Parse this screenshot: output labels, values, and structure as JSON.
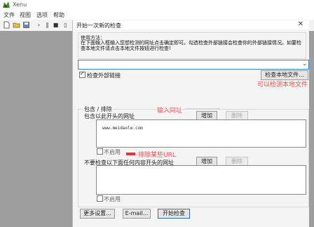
{
  "app": {
    "title": "Xenu"
  },
  "menu": [
    "文件",
    "视图",
    "选项",
    "帮助"
  ],
  "dialog": {
    "title": "开始一次新的检查",
    "usage_title": "使用方法：",
    "usage_text": "在下面输入框输入您想检测的网址点击确定即可。勾选检查外部链接会检查你的外部链接情况。如要检查本地文件请点击本地文件按钮进行检查!",
    "url_value": "",
    "check_external_label": "检查外部链接",
    "check_local_button": "检查本地文件...",
    "include_exclude_title": "包含 / 排除",
    "include_label": "包含以此开头的网址",
    "include_add": "增加",
    "include_delete": "删除",
    "include_items": [
      "www.meidaole.com"
    ],
    "include_disable_label": "不启用",
    "exclude_label": "不要检查以下面任何内容开头的网址",
    "exclude_add": "增加",
    "exclude_delete": "删除",
    "exclude_disable_label": "不启用",
    "more_settings": "更多设置...",
    "email_button": "E-mail...",
    "start_button": "开始检查"
  },
  "annotations": {
    "local_files": "可以检测本地文件",
    "input_url": "输入网址",
    "exclude_url": "排除某些URL"
  },
  "colors": {
    "annotation": "#ee4d4d",
    "focus": "#3b86c8",
    "workspace": "#9e9e9e"
  }
}
